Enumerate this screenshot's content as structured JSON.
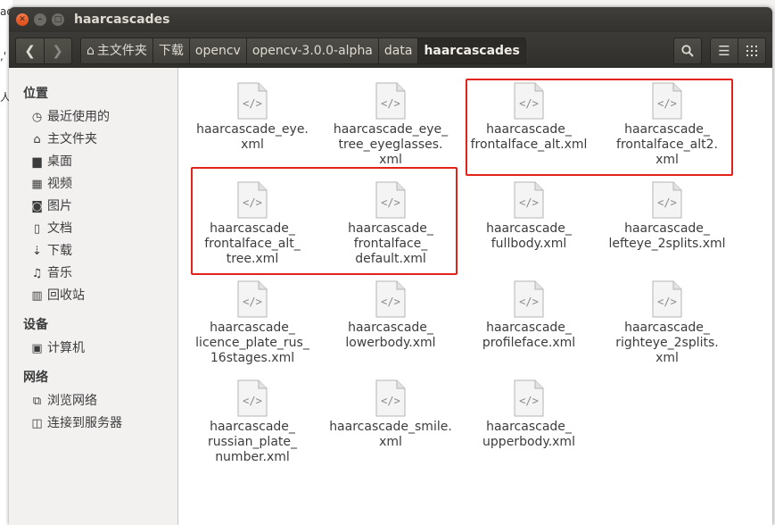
{
  "window": {
    "title": "haarcascades"
  },
  "background_text": [
    "ac",
    ",'",
    "人"
  ],
  "toolbar": {
    "crumbs": [
      "主文件夹",
      "下载",
      "opencv",
      "opencv-3.0.0-alpha",
      "data",
      "haarcascades"
    ]
  },
  "sidebar": {
    "sections": [
      {
        "title": "位置",
        "items": [
          {
            "label": "最近使用的",
            "icon": "clock-icon"
          },
          {
            "label": "主文件夹",
            "icon": "home-icon"
          },
          {
            "label": "桌面",
            "icon": "desktop-icon"
          },
          {
            "label": "视频",
            "icon": "film-icon"
          },
          {
            "label": "图片",
            "icon": "camera-icon"
          },
          {
            "label": "文档",
            "icon": "document-icon"
          },
          {
            "label": "下载",
            "icon": "download-icon"
          },
          {
            "label": "音乐",
            "icon": "music-icon"
          },
          {
            "label": "回收站",
            "icon": "trash-icon"
          }
        ]
      },
      {
        "title": "设备",
        "items": [
          {
            "label": "计算机",
            "icon": "computer-icon"
          }
        ]
      },
      {
        "title": "网络",
        "items": [
          {
            "label": "浏览网络",
            "icon": "network-icon"
          },
          {
            "label": "连接到服务器",
            "icon": "server-icon"
          }
        ]
      }
    ]
  },
  "files": [
    {
      "lines": [
        "haarcascade_eye.",
        "xml"
      ]
    },
    {
      "lines": [
        "haarcascade_eye_",
        "tree_eyeglasses.",
        "xml"
      ]
    },
    {
      "lines": [
        "haarcascade_",
        "frontalface_alt.xml"
      ]
    },
    {
      "lines": [
        "haarcascade_",
        "frontalface_alt2.",
        "xml"
      ]
    },
    {
      "lines": [
        "haarcascade_",
        "frontalface_alt_",
        "tree.xml"
      ]
    },
    {
      "lines": [
        "haarcascade_",
        "frontalface_",
        "default.xml"
      ]
    },
    {
      "lines": [
        "haarcascade_",
        "fullbody.xml"
      ]
    },
    {
      "lines": [
        "haarcascade_",
        "lefteye_2splits.xml"
      ]
    },
    {
      "lines": [
        "haarcascade_",
        "licence_plate_rus_",
        "16stages.xml"
      ]
    },
    {
      "lines": [
        "haarcascade_",
        "lowerbody.xml"
      ]
    },
    {
      "lines": [
        "haarcascade_",
        "profileface.xml"
      ]
    },
    {
      "lines": [
        "haarcascade_",
        "righteye_2splits.",
        "xml"
      ]
    },
    {
      "lines": [
        "haarcascade_",
        "russian_plate_",
        "number.xml"
      ]
    },
    {
      "lines": [
        "haarcascade_smile.",
        "xml"
      ]
    },
    {
      "lines": [
        "haarcascade_",
        "upperbody.xml"
      ]
    }
  ],
  "colors": {
    "highlight": "#e2231a",
    "titlebar": "#3c3b37",
    "close": "#df4a16"
  }
}
